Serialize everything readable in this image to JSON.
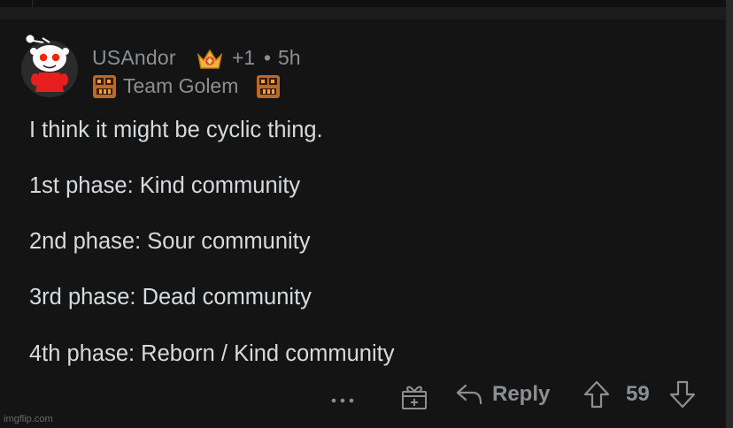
{
  "comment": {
    "author": "USAndor",
    "score_change": "+1",
    "separator": "•",
    "age": "5h",
    "flair": "Team Golem",
    "lines": [
      "I think it might be cyclic thing.",
      "1st phase: Kind community",
      "2nd phase: Sour community",
      "3rd phase: Dead community",
      "4th phase: Reborn / Kind community"
    ]
  },
  "actions": {
    "reply_label": "Reply",
    "vote_count": "59"
  },
  "icons": [
    "snoo-avatar-icon",
    "crown-award-icon",
    "golem-flair-icon",
    "more-options-icon",
    "gift-award-icon",
    "reply-arrow-icon",
    "upvote-arrow-icon",
    "downvote-arrow-icon"
  ],
  "watermark": "imgflip.com",
  "colors": {
    "background": "#141414",
    "body_text": "#d7dadc",
    "muted_text": "#8c8f92",
    "snoo_red": "#ff4500"
  }
}
